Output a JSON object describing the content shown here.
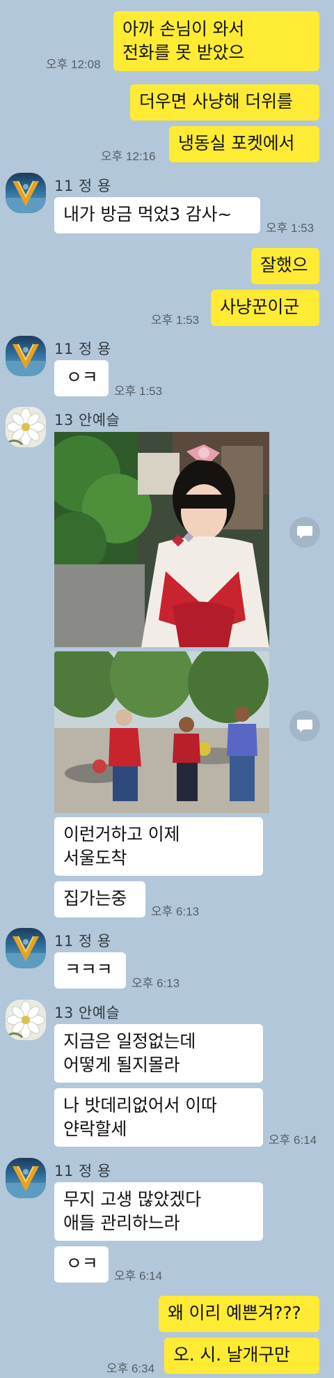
{
  "chat": {
    "messages": [
      {
        "text": "아까 손님이 와서\n전화를 못 받았으",
        "time": "오후 12:08"
      },
      {
        "text": "더우면 사냥해 더위를"
      },
      {
        "text": "냉동실 포켓에서",
        "time": "오후 12:16"
      },
      {
        "sender": "11 정 용",
        "text": "내가 방금 먹었3 감사~",
        "time": "오후 1:53"
      },
      {
        "text": "잘했으"
      },
      {
        "text": "사냥꾼이군",
        "time": "오후 1:53"
      },
      {
        "sender": "11 정 용",
        "text": "ㅇㅋ",
        "time": "오후 1:53"
      },
      {
        "sender": "13 안예슬",
        "text": "이런거하고 이제\n서울도착"
      },
      {
        "text": "집가는중",
        "time": "오후 6:13"
      },
      {
        "sender": "11 정 용",
        "text": "ㅋㅋㅋ",
        "time": "오후 6:13"
      },
      {
        "sender": "13 안예슬",
        "text": "지금은 일정없는데\n어떻게 될지몰라"
      },
      {
        "text": "나 밧데리없어서 이따\n얀락할세",
        "time": "오후 6:14"
      },
      {
        "sender": "11 정 용",
        "text": "무지 고생 많았겠다\n애들 관리하느라"
      },
      {
        "text": "ㅇㅋ",
        "time": "오후 6:14"
      },
      {
        "text": "왜 이리 예쁜겨???"
      },
      {
        "text": "오. 시. 날개구만",
        "time": "오후 6:34"
      }
    ]
  },
  "colors": {
    "background": "#b2c7d9",
    "my_bubble": "#ffeb33",
    "their_bubble": "#ffffff"
  },
  "icons": {
    "share": "speech-bubble-share-icon",
    "avatar_jung": "v-logo-avatar",
    "avatar_ahn": "white-flower-avatar"
  }
}
